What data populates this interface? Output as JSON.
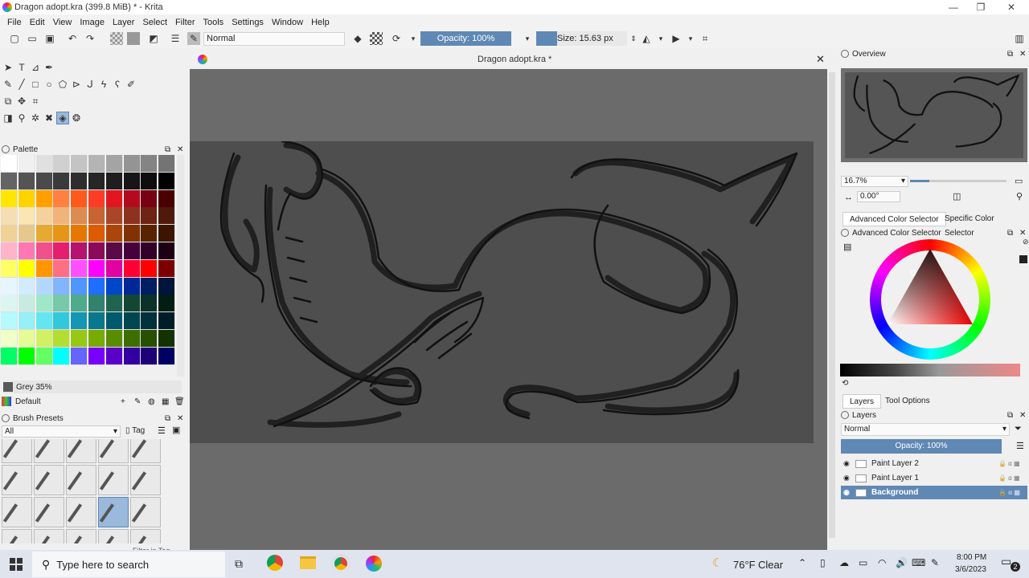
{
  "window": {
    "title": "Dragon adopt.kra (399.8 MiB)  * - Krita",
    "controls": [
      "—",
      "❐",
      "✕"
    ]
  },
  "menu": [
    "File",
    "Edit",
    "View",
    "Image",
    "Layer",
    "Select",
    "Filter",
    "Tools",
    "Settings",
    "Window",
    "Help"
  ],
  "toolbar": {
    "blend_mode": "Normal",
    "opacity": "Opacity: 100%",
    "size": "Size: 15.63 px"
  },
  "document": {
    "tab_title": "Dragon adopt.kra *"
  },
  "palette": {
    "title": "Palette",
    "current_color_name": "Grey 35%",
    "palette_name": "Default",
    "rows": [
      [
        "#ffffff",
        "#f0f0f0",
        "#e0e0e0",
        "#d0d0d0",
        "#c4c4c4",
        "#b4b4b4",
        "#a4a4a4",
        "#949494",
        "#848484",
        "#747474"
      ],
      [
        "#646464",
        "#545454",
        "#4a4a4a",
        "#3a3a3a",
        "#2e2e2e",
        "#262626",
        "#1e1e1e",
        "#161616",
        "#0e0e0e",
        "#000000"
      ],
      [
        "#ffe600",
        "#ffd200",
        "#ffa000",
        "#ff8040",
        "#ff5a1e",
        "#ff3c28",
        "#e1161e",
        "#b40a1e",
        "#780014",
        "#4a0000"
      ],
      [
        "#f5deb4",
        "#fae6b4",
        "#f5d29b",
        "#f0b478",
        "#dc8c50",
        "#c86432",
        "#aa4628",
        "#8c321e",
        "#6e2314",
        "#501a0a"
      ],
      [
        "#f0d296",
        "#e6c88c",
        "#e6aa32",
        "#e69614",
        "#e67800",
        "#dc5a00",
        "#aa460a",
        "#823200",
        "#5a2300",
        "#3c1400"
      ],
      [
        "#ffb4c8",
        "#ff78b4",
        "#f0508c",
        "#e61e6e",
        "#b4146e",
        "#8c0a5a",
        "#5a0a46",
        "#46003c",
        "#320028",
        "#1e0014"
      ],
      [
        "#ffff64",
        "#ffff00",
        "#ff9600",
        "#ff6e82",
        "#ff50ff",
        "#ff00ff",
        "#e100a0",
        "#ff0032",
        "#ff0000",
        "#7d0000"
      ],
      [
        "#e6f5ff",
        "#d2ebff",
        "#b4d7ff",
        "#82b4ff",
        "#5096ff",
        "#1e6eff",
        "#0046c8",
        "#002896",
        "#001e64",
        "#00143c"
      ],
      [
        "#dcf5f0",
        "#c8ebe1",
        "#a0e6c8",
        "#78c8aa",
        "#50aa8c",
        "#32826e",
        "#1e6450",
        "#144632",
        "#0a3228",
        "#001e14"
      ],
      [
        "#b4faff",
        "#96f0f5",
        "#64e6f0",
        "#32c8dc",
        "#1496b4",
        "#0a788c",
        "#005a6e",
        "#004650",
        "#00323c",
        "#001e28"
      ],
      [
        "#f0ffc8",
        "#e6fa96",
        "#d2f064",
        "#b4dc32",
        "#96c814",
        "#78aa00",
        "#5a8c00",
        "#3c6e00",
        "#285000",
        "#143200"
      ],
      [
        "#00ff64",
        "#00ff00",
        "#64ff64",
        "#00ffff",
        "#6464ff",
        "#7800ff",
        "#5a00c8",
        "#3200a0",
        "#1e0078",
        "#000064"
      ]
    ]
  },
  "brushes": {
    "title": "Brush Presets",
    "filter": "All",
    "tag": "Tag",
    "filter_label": "Filter in Tag"
  },
  "overview": {
    "title": "Overview",
    "zoom": "16.7%",
    "rotation": "0.00°"
  },
  "color": {
    "tabs": [
      "Advanced Color Selector",
      "Specific Color Selector"
    ],
    "title": "Advanced Color Selector"
  },
  "layers": {
    "tabs": [
      "Layers",
      "Tool Options"
    ],
    "title": "Layers",
    "blend_mode": "Normal",
    "opacity": "Opacity:  100%",
    "items": [
      {
        "name": "Paint Layer 2",
        "selected": false
      },
      {
        "name": "Paint Layer 1",
        "selected": false
      },
      {
        "name": "Background",
        "selected": true
      }
    ]
  },
  "taskbar": {
    "search_placeholder": "Type here to search",
    "weather_temp": "76°F",
    "weather_desc": "Clear",
    "time": "8:00 PM",
    "date": "3/6/2023",
    "notifications": "2"
  }
}
